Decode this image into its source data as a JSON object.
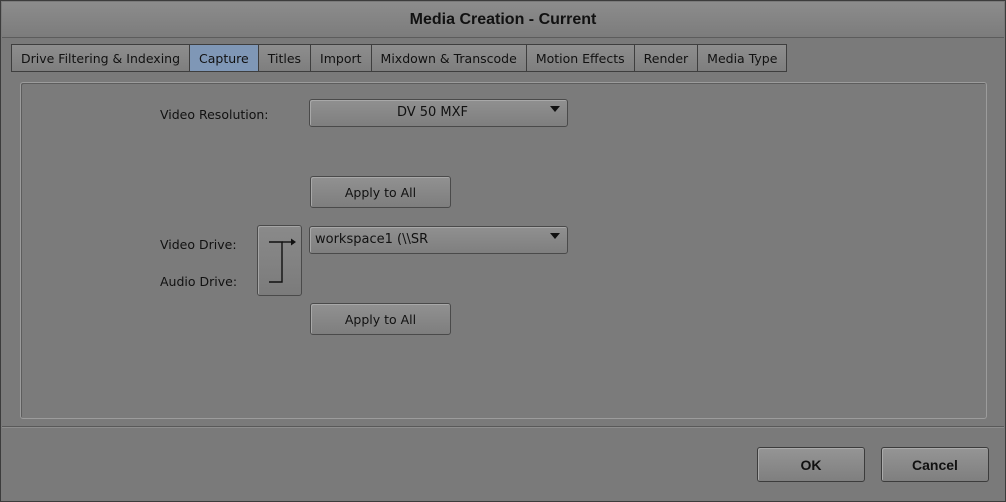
{
  "window": {
    "title": "Media Creation - Current"
  },
  "tabs": [
    {
      "label": "Drive Filtering & Indexing",
      "active": false
    },
    {
      "label": "Capture",
      "active": true
    },
    {
      "label": "Titles",
      "active": false
    },
    {
      "label": "Import",
      "active": false
    },
    {
      "label": "Mixdown & Transcode",
      "active": false
    },
    {
      "label": "Motion Effects",
      "active": false
    },
    {
      "label": "Render",
      "active": false
    },
    {
      "label": "Media Type",
      "active": false
    }
  ],
  "capture": {
    "video_resolution_label": "Video Resolution:",
    "video_resolution_value": "DV 50  MXF",
    "apply_all_resolution": "Apply to All",
    "video_drive_label": "Video Drive:",
    "audio_drive_label": "Audio Drive:",
    "drive_value": "workspace1 (\\\\SR",
    "apply_all_drives": "Apply to All",
    "link_icon": "bracket-link-icon"
  },
  "footer": {
    "ok": "OK",
    "cancel": "Cancel"
  },
  "colors": {
    "active_tab": "#7f97b6",
    "background": "#7a7a7a"
  }
}
